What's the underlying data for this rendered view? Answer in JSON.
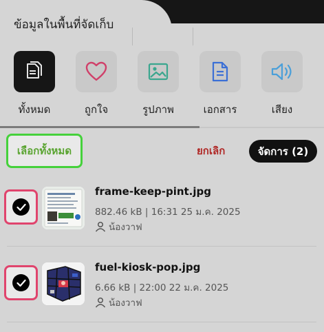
{
  "header": {
    "title": "ข้อมูลในพื้นที่จัดเก็บ"
  },
  "categories": [
    {
      "label": "ทั้งหมด",
      "icon": "files-icon",
      "active": true
    },
    {
      "label": "ถูกใจ",
      "icon": "heart-icon",
      "active": false
    },
    {
      "label": "รูปภาพ",
      "icon": "image-icon",
      "active": false
    },
    {
      "label": "เอกสาร",
      "icon": "document-icon",
      "active": false
    },
    {
      "label": "เสียง",
      "icon": "speaker-icon",
      "active": false
    }
  ],
  "actions": {
    "select_all": "เลือกทั้งหมด",
    "cancel": "ยกเลิก",
    "manage": "จัดการ (2)"
  },
  "files": [
    {
      "name": "frame-keep-pint.jpg",
      "meta": "882.46 kB | 16:31 25 ม.ค. 2025",
      "owner": "น้องวาฟ",
      "checked": true
    },
    {
      "name": "fuel-kiosk-pop.jpg",
      "meta": "6.66 kB | 22:00 22 ม.ค. 2025",
      "owner": "น้องวาฟ",
      "checked": true
    }
  ],
  "colors": {
    "select_all_border": "#45d13b",
    "select_all_text": "#5aa431",
    "cancel_text": "#b02826",
    "check_border": "#e0446d",
    "heart": "#d0406a",
    "image": "#3aa68e",
    "document": "#3b6fd6",
    "speaker": "#4a9fd9"
  }
}
